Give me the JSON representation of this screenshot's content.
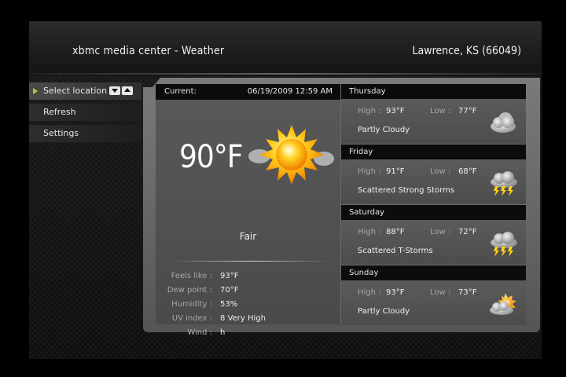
{
  "header": {
    "app_title": "xbmc media center - Weather",
    "location": "Lawrence, KS (66049)"
  },
  "menu": {
    "items": [
      {
        "label": "Select location",
        "selected": true
      },
      {
        "label": "Refresh",
        "selected": false
      },
      {
        "label": "Settings",
        "selected": false
      }
    ]
  },
  "current": {
    "label": "Current:",
    "datetime": "06/19/2009 12:59 AM",
    "temperature": "90°F",
    "condition": "Fair",
    "icon": "sun-icon",
    "details": [
      {
        "label": "Feels like :",
        "value": "93°F"
      },
      {
        "label": "Dew point :",
        "value": "70°F"
      },
      {
        "label": "Humidity :",
        "value": "53%"
      },
      {
        "label": "UV index :",
        "value": "8 Very High"
      },
      {
        "label": "Wind :",
        "value": "h"
      }
    ]
  },
  "forecast_labels": {
    "high": "High :",
    "low": "Low :"
  },
  "forecast": [
    {
      "day": "Thursday",
      "high": "93°F",
      "low": "77°F",
      "condition": "Partly Cloudy",
      "icon": "partly-cloudy-night-icon"
    },
    {
      "day": "Friday",
      "high": "91°F",
      "low": "68°F",
      "condition": "Scattered Strong Storms",
      "icon": "thunderstorm-icon"
    },
    {
      "day": "Saturday",
      "high": "88°F",
      "low": "72°F",
      "condition": "Scattered T-Storms",
      "icon": "thunderstorm-icon"
    },
    {
      "day": "Sunday",
      "high": "93°F",
      "low": "73°F",
      "condition": "Partly Cloudy",
      "icon": "partly-cloudy-day-icon"
    }
  ],
  "colors": {
    "menu_arrow": "#b9c83a",
    "header_bar": "#0c0c0c",
    "panel": "#555555"
  }
}
